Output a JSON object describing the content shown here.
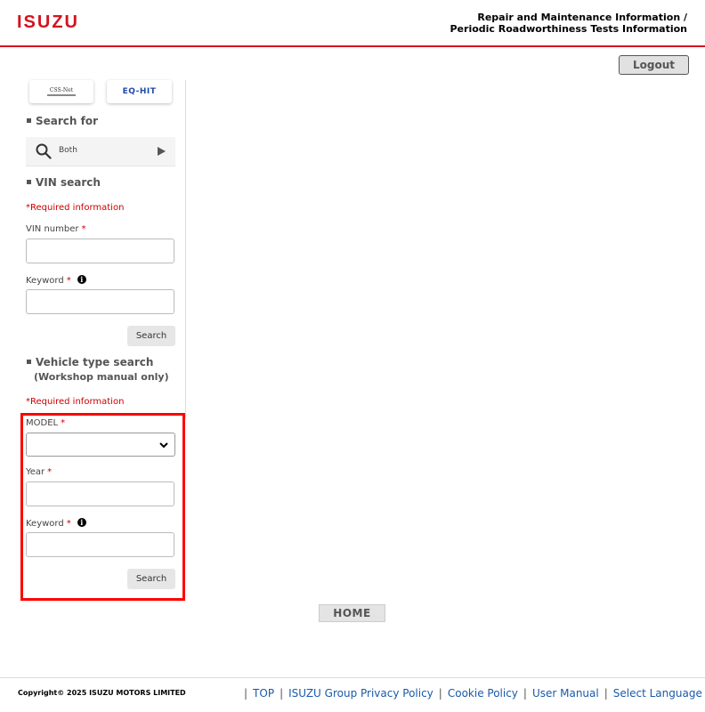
{
  "header": {
    "brand": "ISUZU",
    "title_line1": "Repair and Maintenance Information /",
    "title_line2": "Periodic Roadworthiness Tests Information",
    "logout_label": "Logout",
    "brand_color": "#d2141e"
  },
  "sidebar": {
    "banners": [
      {
        "name": "CSS-Net",
        "label": "CSS-Net"
      },
      {
        "name": "EQ-HIT",
        "label": "EQ-HIT"
      }
    ],
    "search_for": {
      "title": "Search for",
      "value": "Both",
      "icon": "search-icon"
    },
    "vin_search": {
      "title": "VIN search",
      "required_note": "*Required information",
      "vin_label": "VIN number",
      "keyword_label": "Keyword",
      "required_mark": "*",
      "search_label": "Search"
    },
    "vehicle_type_search": {
      "title": "Vehicle type search",
      "subtitle": "(Workshop manual only)",
      "required_note": "*Required information",
      "model_label": "MODEL",
      "year_label": "Year",
      "keyword_label": "Keyword",
      "required_mark": "*",
      "search_label": "Search"
    }
  },
  "main": {
    "home_label": "HOME"
  },
  "footer": {
    "copyright": "Copyright© 2025 ISUZU MOTORS LIMITED",
    "links": [
      "TOP",
      "ISUZU Group Privacy Policy",
      "Cookie Policy",
      "User Manual",
      "Select Language"
    ]
  }
}
